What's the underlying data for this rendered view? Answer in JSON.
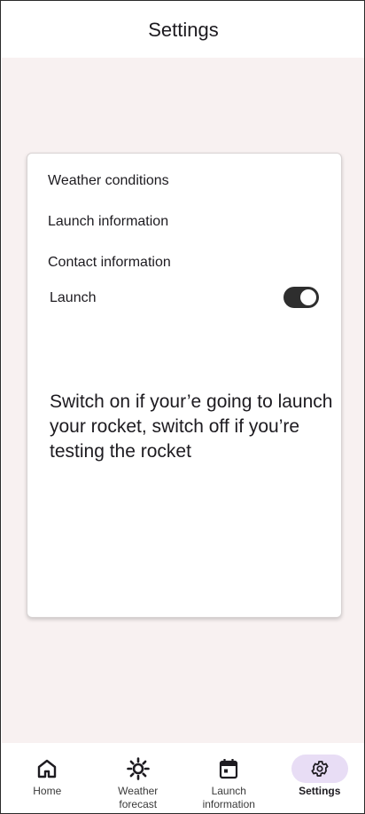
{
  "app_bar": {
    "title": "Settings"
  },
  "settings": {
    "items": [
      {
        "label": "Weather conditions"
      },
      {
        "label": "Launch information"
      },
      {
        "label": "Contact information"
      }
    ],
    "launch_toggle": {
      "label": "Launch",
      "state": "on"
    },
    "help_text": "Switch on if your’e going to launch your rocket, switch off if you’re testing the rocket"
  },
  "nav": {
    "items": [
      {
        "label": "Home",
        "icon": "home-icon"
      },
      {
        "label": "Weather forecast",
        "icon": "sun-icon"
      },
      {
        "label": "Launch information",
        "icon": "calendar-icon"
      },
      {
        "label": "Settings",
        "icon": "gear-icon",
        "active": true
      }
    ]
  },
  "colors": {
    "content_background": "#f8f1f1",
    "active_nav_indicator": "#e8ddf5",
    "toggle_track": "#2e2e2e"
  }
}
